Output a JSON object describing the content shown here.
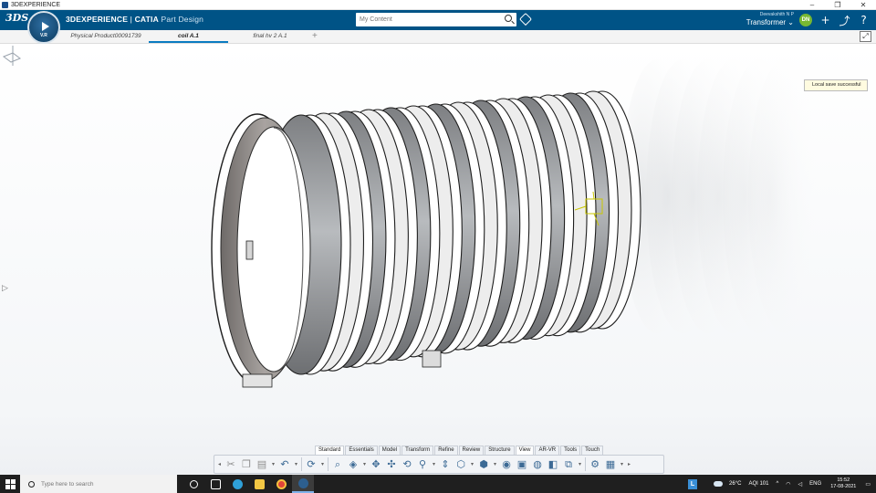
{
  "os": {
    "title": "3DEXPERIENCE",
    "controls": [
      "–",
      "❐",
      "✕"
    ]
  },
  "topbar": {
    "logo": "3DS",
    "brand_bold": "3DEXPERIENCE",
    "brand_sep": " | ",
    "brand_product": "CATIA",
    "brand_app": " Part Design",
    "search_placeholder": "My Content",
    "user_name": "Deevakshith N P",
    "role": "Transformer ⌄",
    "avatar_initials": "DN",
    "icons": [
      "+",
      "⤴",
      "?"
    ]
  },
  "compass": {
    "version": "V.R"
  },
  "tabs": [
    {
      "label": "Physical Product00091739",
      "active": false
    },
    {
      "label": "coil A.1",
      "active": true
    },
    {
      "label": "final hv 2 A.1",
      "active": false
    }
  ],
  "tab_add": "+",
  "toast": "Local save successful",
  "action_tabs": [
    "Standard",
    "Essentials",
    "Model",
    "Transform",
    "Refine",
    "Review",
    "Structure",
    "View",
    "AR-VR",
    "Tools",
    "Touch"
  ],
  "action_tabs_active": "View",
  "taskbar": {
    "search_placeholder": "Type here to search",
    "weather": "26°C",
    "aqi": "AQI 101",
    "lang": "ENG",
    "time": "15:52",
    "date": "17-08-2021"
  },
  "colors": {
    "brand_blue": "#005386",
    "active_tab": "#0b7bc1",
    "taskbar": "#1f1f1f"
  }
}
